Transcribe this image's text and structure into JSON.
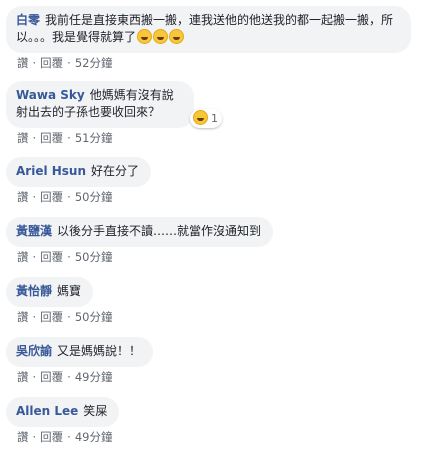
{
  "comments": [
    {
      "author": "白零",
      "text": "我前任是直接東西搬一搬，連我送他的他送我的都一起搬一搬，所以。。。我是覺得就算了",
      "emojis": [
        "grinning-squint-icon",
        "grinning-squint-icon",
        "grinning-squint-icon"
      ],
      "like": "讚",
      "reply": "回覆",
      "time": "52分鐘"
    },
    {
      "author": "Wawa Sky",
      "text": "他媽媽有沒有說射出去的子孫也要收回來？",
      "reaction_count": "1",
      "like": "讚",
      "reply": "回覆",
      "time": "51分鐘"
    },
    {
      "author": "Ariel Hsun",
      "text": "好在分了",
      "like": "讚",
      "reply": "回覆",
      "time": "50分鐘"
    },
    {
      "author": "黃鹽漢",
      "text": "以後分手直接不讀……就當作沒通知到",
      "like": "讚",
      "reply": "回覆",
      "time": "50分鐘"
    },
    {
      "author": "黃怡靜",
      "text": "媽寶",
      "like": "讚",
      "reply": "回覆",
      "time": "50分鐘"
    },
    {
      "author": "吳欣諭",
      "text": "又是媽媽說！！",
      "like": "讚",
      "reply": "回覆",
      "time": "49分鐘"
    },
    {
      "author": "Allen Lee",
      "text": "笑屎",
      "like": "讚",
      "reply": "回覆",
      "time": "49分鐘"
    }
  ],
  "colors": {
    "bubble": "#f2f3f5",
    "author": "#385898",
    "meta": "#606770"
  }
}
